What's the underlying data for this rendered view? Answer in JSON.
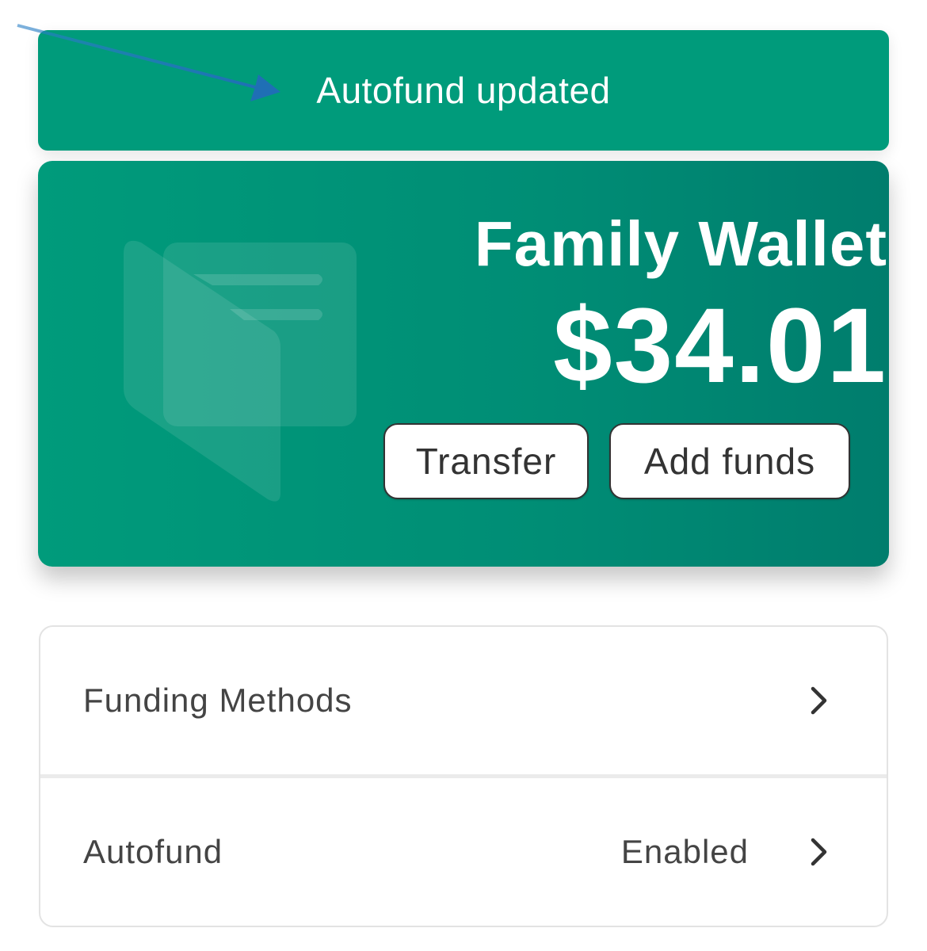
{
  "toast": {
    "message": "Autofund updated",
    "bg_color": "#009b7b"
  },
  "wallet": {
    "title": "Family Wallet",
    "balance": "$34.01",
    "gradient_start": "#009b7b",
    "gradient_end": "#008070",
    "transfer_label": "Transfer",
    "add_funds_label": "Add funds"
  },
  "settings": {
    "rows": [
      {
        "label": "Funding Methods",
        "value": ""
      },
      {
        "label": "Autofund",
        "value": "Enabled"
      }
    ]
  },
  "annotation": {
    "arrow_color": "#1f6fb5"
  }
}
